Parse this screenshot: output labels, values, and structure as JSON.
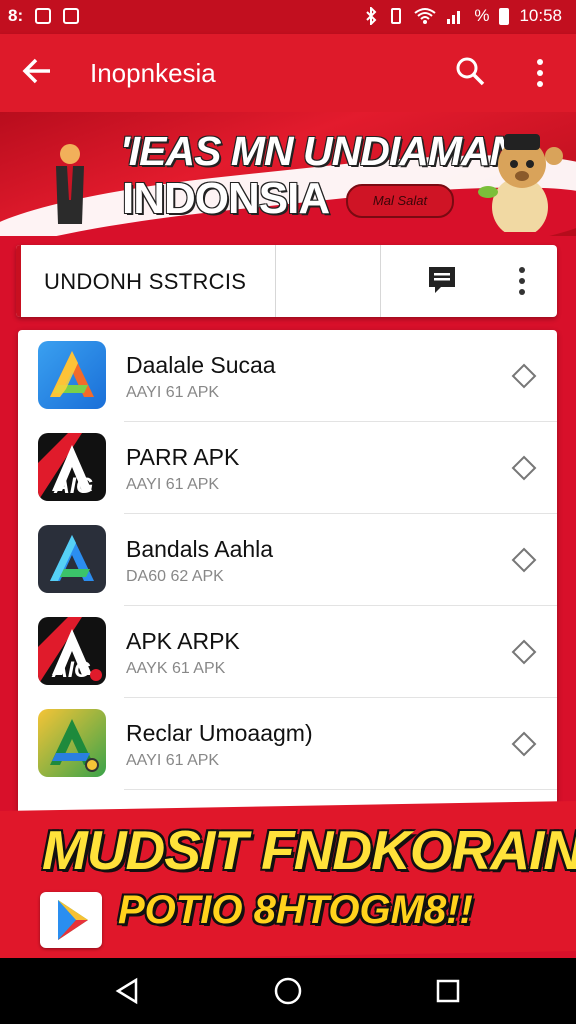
{
  "status_bar": {
    "left_text": "8:",
    "battery_text": "%",
    "time": "10:58"
  },
  "app_bar": {
    "title": "Inopnkesia",
    "icons": [
      "back-arrow-icon",
      "search-icon",
      "more-vert-icon"
    ]
  },
  "banner": {
    "headline_1": "'IEAS MN UNDIAMAN",
    "headline_2": "INDONSIA",
    "pill_text": "Mal Salat"
  },
  "toolbar": {
    "label": "UNDONH SSTRCIS",
    "icons": [
      "chat-icon",
      "more-vert-icon"
    ]
  },
  "apps": [
    {
      "name": "Daalale Sucaa",
      "subtitle": "AAYI 61 APK",
      "icon": "prism-a-icon"
    },
    {
      "name": "PARR APK",
      "subtitle": "AAYI 61 APK",
      "icon": "red-a-icon"
    },
    {
      "name": "Bandals Aahla",
      "subtitle": "DA60 62 APK",
      "icon": "blue-a-icon"
    },
    {
      "name": "APK  ARPK",
      "subtitle": "AAYK 61 APK",
      "icon": "red-a-icon"
    },
    {
      "name": "Reclar Umoaagm)",
      "subtitle": "AAYI 61 APK",
      "icon": "green-a-icon"
    }
  ],
  "promo": {
    "line_1": "MUDSIT FNDKORAIN",
    "line_2": "POTIO 8HTOGM8!!"
  },
  "nav_bar": {
    "icons": [
      "back-triangle-icon",
      "home-circle-icon",
      "recents-square-icon"
    ]
  },
  "colors": {
    "primary_red": "#de1a2a",
    "status_red": "#c20f1f",
    "promo_yellow": "#ffe23a"
  }
}
